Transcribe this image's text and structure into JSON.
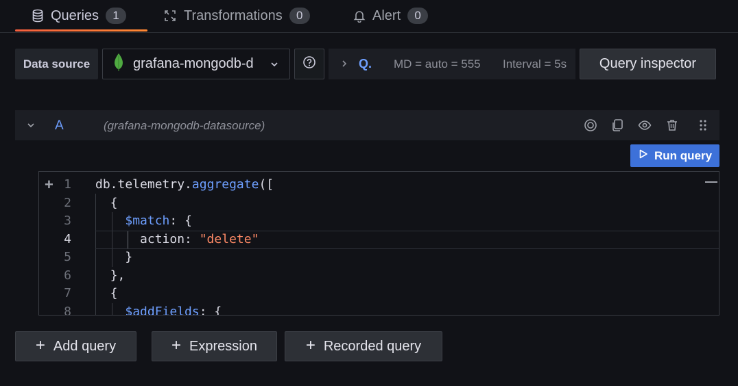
{
  "tabs": [
    {
      "label": "Queries",
      "count": "1",
      "icon": "database-icon"
    },
    {
      "label": "Transformations",
      "count": "0",
      "icon": "transform-icon"
    },
    {
      "label": "Alert",
      "count": "0",
      "icon": "bell-icon"
    }
  ],
  "datasource": {
    "label": "Data source",
    "selected": "grafana-mongodb-d",
    "icon": "mongodb-leaf-icon"
  },
  "query_options": {
    "title": "Q.",
    "max_data_points": "MD = auto = 555",
    "interval": "Interval = 5s"
  },
  "inspector_label": "Query inspector",
  "query": {
    "ref_id": "A",
    "datasource_name": "(grafana-mongodb-datasource)"
  },
  "run_query_label": "Run query",
  "editor": {
    "line_numbers": [
      "1",
      "2",
      "3",
      "4",
      "5",
      "6",
      "7",
      "8"
    ],
    "active_line": "4"
  },
  "bottom": {
    "add_query": "Add query",
    "expression": "Expression",
    "recorded_query": "Recorded query"
  },
  "colors": {
    "accent_blue": "#3d71d9",
    "tab_underline": "#f55f3e",
    "mongo_green": "#4faa41"
  }
}
